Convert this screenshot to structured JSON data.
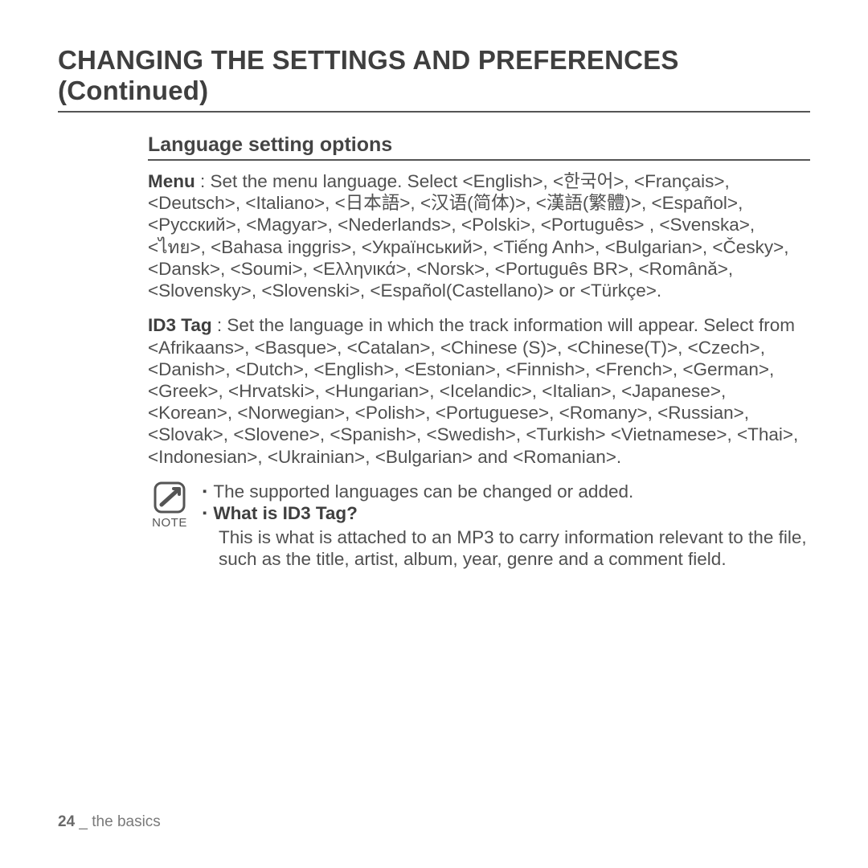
{
  "title": "CHANGING THE SETTINGS AND PREFERENCES (Continued)",
  "section": {
    "heading": "Language setting options",
    "menu_label": "Menu",
    "menu_text": " : Set the menu language. Select <English>, <한국어>, <Français>, <Deutsch>, <Italiano>, <日本語>, <汉语(简体)>, <漢語(繁體)>, <Español>, <Русский>, <Magyar>, <Nederlands>, <Polski>, <Português> , <Svenska>, <ไทย>, <Bahasa inggris>, <Український>, <Tiếng Anh>, <Bulgarian>, <Česky>, <Dansk>, <Soumi>, <Ελληνικά>, <Norsk>, <Português BR>, <Română>, <Slovensky>, <Slovenski>, <Español(Castellano)> or <Türkçe>.",
    "id3_label": "ID3 Tag",
    "id3_text": " : Set the language in which the track information will appear. Select from <Afrikaans>, <Basque>, <Catalan>, <Chinese (S)>, <Chinese(T)>, <Czech>, <Danish>, <Dutch>, <English>, <Estonian>, <Finnish>, <French>, <German>, <Greek>, <Hrvatski>, <Hungarian>, <Icelandic>, <Italian>, <Japanese>, <Korean>, <Norwegian>, <Polish>, <Portuguese>, <Romany>, <Russian>, <Slovak>, <Slovene>, <Spanish>, <Swedish>, <Turkish> <Vietnamese>, <Thai>, <Indonesian>, <Ukrainian>, <Bulgarian> and <Romanian>."
  },
  "note": {
    "label": "NOTE",
    "line1": "The supported languages can be changed or added.",
    "question": "What is ID3 Tag?",
    "explain": "This is what is attached to an MP3 to carry information relevant to the file, such as the title, artist, album, year, genre and a comment field."
  },
  "footer": {
    "page": "24",
    "sep": " _ ",
    "section": "the basics"
  }
}
